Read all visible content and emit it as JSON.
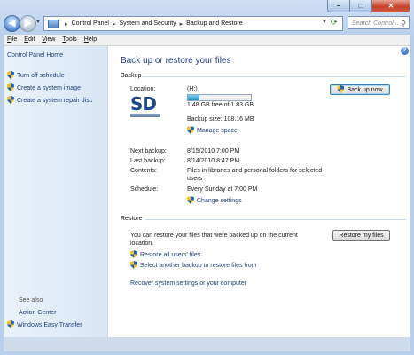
{
  "nav": {
    "breadcrumb": [
      "Control Panel",
      "System and Security",
      "Backup and Restore"
    ],
    "search_placeholder": "Search Control..."
  },
  "menu": [
    "File",
    "Edit",
    "View",
    "Tools",
    "Help"
  ],
  "sidebar": {
    "home": "Control Panel Home",
    "tasks": [
      "Turn off schedule",
      "Create a system image",
      "Create a system repair disc"
    ],
    "see_also_heading": "See also",
    "see_also": [
      "Action Center",
      "Windows Easy Transfer"
    ]
  },
  "main": {
    "title": "Back up or restore your files",
    "backup": {
      "heading": "Backup",
      "location_label": "Location:",
      "location_value": "(H:)",
      "drive_icon_text": "SD",
      "free_space": "1.48 GB free of 1.83 GB",
      "used_fraction": 0.19,
      "backup_size": "Backup size: 108.16 MB",
      "manage_space": "Manage space",
      "backup_now": "Back up now",
      "next_label": "Next backup:",
      "next_value": "8/15/2010 7:00 PM",
      "last_label": "Last backup:",
      "last_value": "8/14/2010 8:47 PM",
      "contents_label": "Contents:",
      "contents_line1": "Files in libraries and personal folders for selected",
      "contents_line2": "users",
      "schedule_label": "Schedule:",
      "schedule_value": "Every Sunday at 7:00 PM",
      "change_settings": "Change settings"
    },
    "restore": {
      "heading": "Restore",
      "desc_line1": "You can restore your files that were backed up on the current",
      "desc_line2": "location.",
      "restore_my_files": "Restore my files",
      "restore_all": "Restore all users' files",
      "select_another": "Select another backup to restore files from",
      "recover": "Recover system settings or your computer"
    }
  },
  "colors": {
    "link": "#1e3f78",
    "title": "#1e3d8a",
    "accent": "#1e8fc6"
  }
}
